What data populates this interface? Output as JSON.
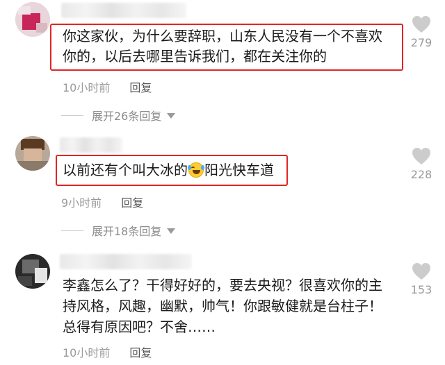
{
  "colors": {
    "highlight_border": "#e02525",
    "like_icon": "#cccccc",
    "meta_text": "#9a9a9a"
  },
  "comments": [
    {
      "text_lines": [
        "你这家伙，为什么要辞职，山东人民没有一个不喜欢",
        "你的，以后去哪里告诉我们，都在关注你的"
      ],
      "time": "10小时前",
      "reply_label": "回复",
      "likes": "279",
      "expand_label": "展开26条回复",
      "highlighted": true
    },
    {
      "text_before": "以前还有个叫大冰的",
      "emoji": "rolling-laughing-emoji",
      "text_after": "阳光快车道",
      "time": "9小时前",
      "reply_label": "回复",
      "likes": "228",
      "expand_label": "展开18条回复",
      "highlighted": true
    },
    {
      "text_lines": [
        "李鑫怎么了？干得好好的，要去央视？很喜欢你的主",
        "持风格，风趣，幽默，帅气！你跟敏健就是台柱子！",
        "总得有原因吧？不舍……"
      ],
      "time": "10小时前",
      "reply_label": "回复",
      "likes": "153",
      "highlighted": false
    }
  ]
}
